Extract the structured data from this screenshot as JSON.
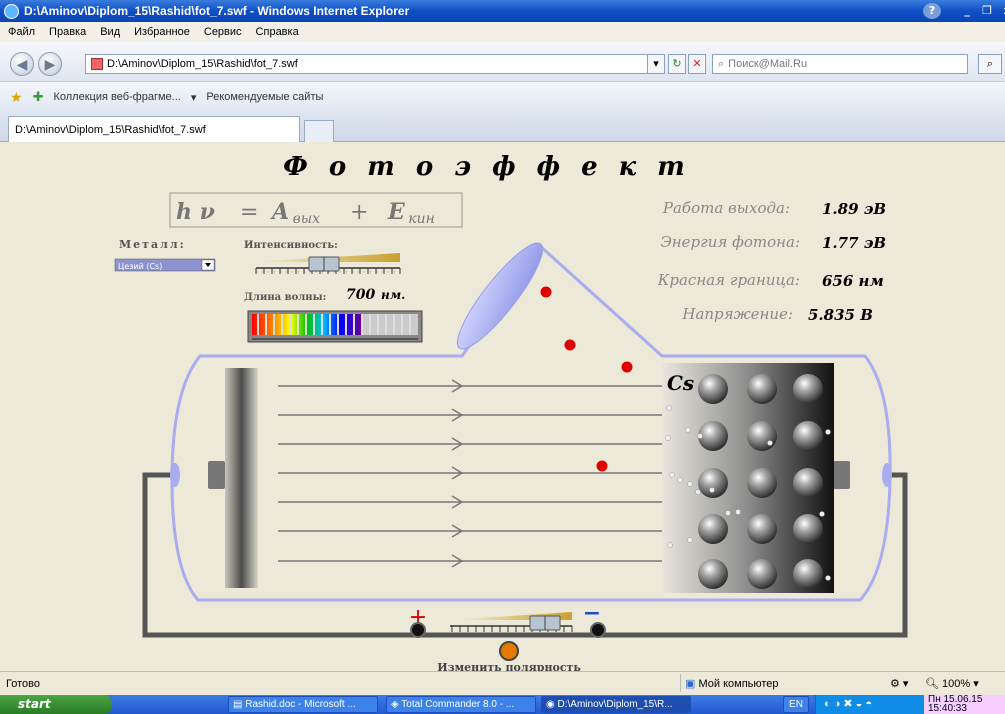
{
  "window": {
    "title": "D:\\Aminov\\Diplom_15\\Rashid\\fot_7.swf - Windows Internet Explorer"
  },
  "menu": [
    "Файл",
    "Правка",
    "Вид",
    "Избранное",
    "Сервис",
    "Справка"
  ],
  "address": {
    "url": "D:\\Aminov\\Diplom_15\\Rashid\\fot_7.swf",
    "search_placeholder": "Поиск@Mail.Ru"
  },
  "favorites": {
    "item1": "Коллекция веб-фрагме...",
    "item2": "Рекомендуемые сайты"
  },
  "tab": {
    "label": "D:\\Aminov\\Diplom_15\\Rashid\\fot_7.swf"
  },
  "sim": {
    "title": "Ф о т о э ф ф е к т",
    "formula_lhs": "h ν",
    "formula_eq": "=",
    "formula_a": "A",
    "formula_a_sub": "вых",
    "formula_plus": "+",
    "formula_e": "E",
    "formula_e_sub": "кин",
    "metal_label": "Металл:",
    "metal_value": "Цезий (Cs)",
    "intensity_label": "Интенсивность:",
    "wavelength_label": "Длина волны:",
    "wavelength_value": "700",
    "wavelength_unit": "нм.",
    "work_label": "Работа выхода:",
    "work_value": "1.89 эВ",
    "photon_label": "Энергия фотона:",
    "photon_value": "1.77 эВ",
    "red_label": "Красная граница:",
    "red_value": "656 нм",
    "voltage_label": "Напряжение:",
    "voltage_value": "5.835 В",
    "element": "Cs",
    "plus": "+",
    "minus": "−",
    "polarity_label": "Изменить полярность"
  },
  "status": {
    "text": "Готово",
    "zone": "Мой компьютер",
    "zoom": "100%"
  },
  "taskbar": {
    "start": "start",
    "tasks": [
      "Rashid.doc - Microsoft ...",
      "Total Commander 8.0 - ...",
      "D:\\Aminov\\Diplom_15\\R..."
    ],
    "lang": "EN",
    "clock": "Пн 15.06.15",
    "time": "15:40:33"
  },
  "colors": {
    "accent": "#0a45b8",
    "tube": "#a9acee",
    "electron": "#e00000"
  }
}
